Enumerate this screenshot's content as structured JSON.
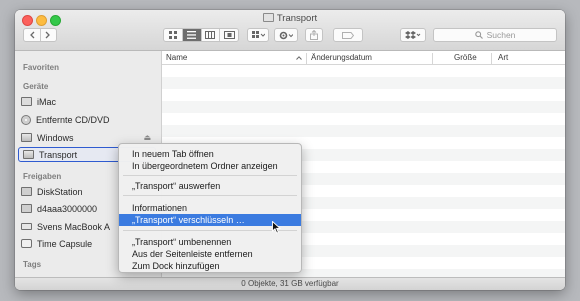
{
  "window": {
    "title": "Transport"
  },
  "toolbar": {
    "back_icon": "chevron-left-icon",
    "forward_icon": "chevron-right-icon",
    "view_modes": [
      "icon-view",
      "list-view",
      "column-view",
      "gallery-view"
    ],
    "active_view": "list-view",
    "search_placeholder": "Suchen"
  },
  "sidebar": {
    "favorites_header": "Favoriten",
    "devices_header": "Geräte",
    "devices": [
      {
        "label": "iMac",
        "icon": "imac-icon"
      },
      {
        "label": "Entfernte CD/DVD",
        "icon": "cd-icon"
      },
      {
        "label": "Windows",
        "icon": "drive-icon"
      },
      {
        "label": "Transport",
        "icon": "drive-icon"
      }
    ],
    "shared_header": "Freigaben",
    "shared": [
      {
        "label": "DiskStation",
        "icon": "server-icon"
      },
      {
        "label": "d4aaa3000000",
        "icon": "server-icon"
      },
      {
        "label": "Svens MacBook A",
        "icon": "laptop-icon"
      },
      {
        "label": "Time Capsule",
        "icon": "time-capsule-icon"
      }
    ],
    "tags_header": "Tags"
  },
  "columns": {
    "name": "Name",
    "date": "Änderungsdatum",
    "size": "Größe",
    "kind": "Art"
  },
  "status": {
    "text": "0 Objekte, 31 GB verfügbar"
  },
  "context_menu": {
    "items": [
      "In neuem Tab öffnen",
      "In übergeordnetem Ordner anzeigen",
      "„Transport“ auswerfen",
      "Informationen",
      "„Transport“ verschlüsseln …",
      "„Transport“ umbenennen",
      "Aus der Seitenleiste entfernen",
      "Zum Dock hinzufügen"
    ],
    "highlighted_index": 4
  },
  "colors": {
    "highlight": "#3b7be0",
    "selection_outline": "#2f5bd0",
    "close": "#fc605b",
    "minimize": "#fdbc40",
    "maximize": "#34c84a"
  }
}
